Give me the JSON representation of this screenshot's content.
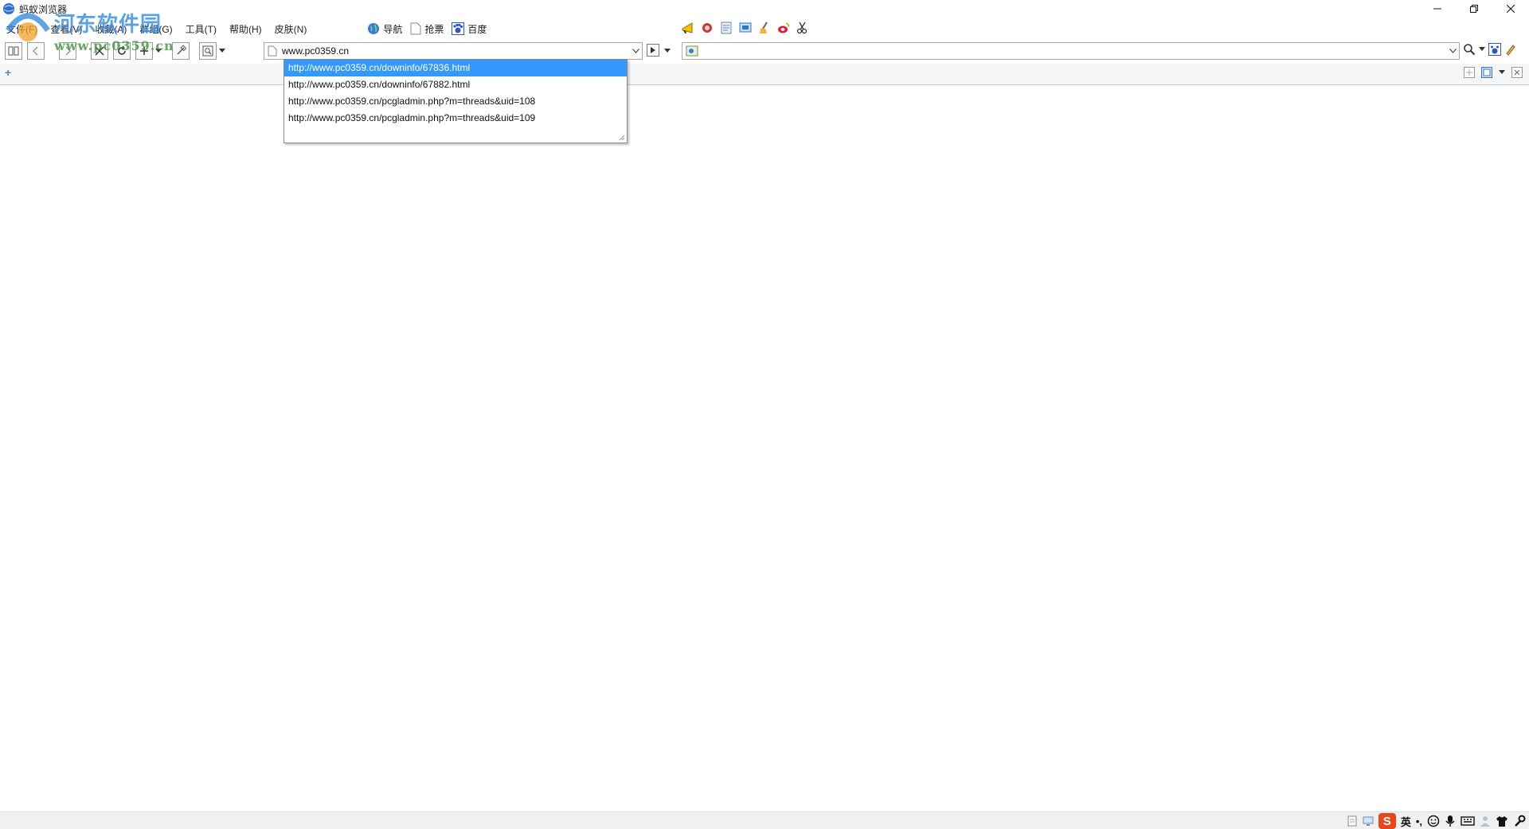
{
  "window": {
    "title": "蚂蚁浏览器"
  },
  "watermark": {
    "title": "河东软件园",
    "subtitle": "www.pc0359.cn"
  },
  "menu": {
    "items": [
      "文件(F)",
      "查看(V)",
      "收藏(A)",
      "群组(G)",
      "工具(T)",
      "帮助(H)",
      "皮肤(N)"
    ]
  },
  "quicklinks": [
    {
      "label": "导航",
      "icon": "globe-icon"
    },
    {
      "label": "抢票",
      "icon": "page-icon"
    },
    {
      "label": "百度",
      "icon": "baidu-icon"
    }
  ],
  "address": {
    "value": "www.pc0359.cn"
  },
  "search": {
    "value": ""
  },
  "autocomplete": {
    "items": [
      "http://www.pc0359.cn/downinfo/67836.html",
      "http://www.pc0359.cn/downinfo/67882.html",
      "http://www.pc0359.cn/pcgladmin.php?m=threads&uid=108",
      "http://www.pc0359.cn/pcgladmin.php?m=threads&uid=109"
    ],
    "selected_index": 0
  },
  "tabbar": {
    "add_label": "+"
  },
  "statusbar": {
    "ime_logo": "S",
    "ime_mode": "英",
    "ime_punct": "•,"
  },
  "colors": {
    "selection": "#3399ff",
    "ime": "#e8461b"
  }
}
